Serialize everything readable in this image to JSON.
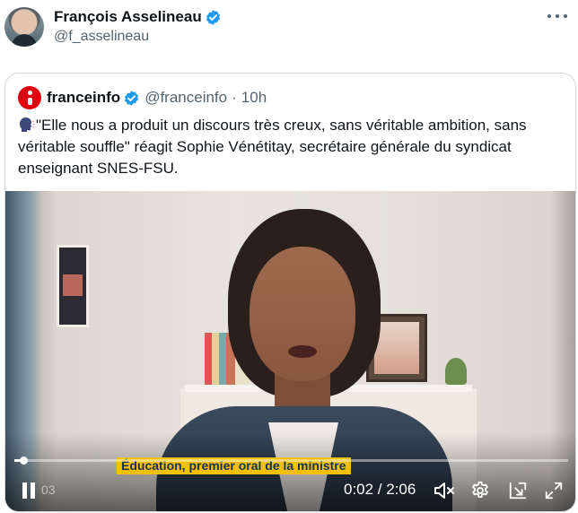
{
  "post": {
    "author_name": "François Asselineau",
    "author_handle": "@f_asselineau",
    "more_icon": "more-horizontal-icon"
  },
  "quoted": {
    "name": "franceinfo",
    "handle": "@franceinfo",
    "separator": "·",
    "time": "10h",
    "text": "\"Elle nous a produit un discours très creux, sans véritable ambition, sans véritable souffle\" réagit Sophie Vénétitay, secrétaire générale du syndicat enseignant SNES-FSU.",
    "leading_icon": "speaking-head-icon"
  },
  "video": {
    "caption": "Éducation, premier oral de la ministre",
    "time_display": "0:02 / 2:06",
    "faded_time": "03",
    "progress": 0.016
  },
  "colors": {
    "verified": "#1d9bf0",
    "franceinfo_red": "#e1000f",
    "caption_bg": "#f2c000",
    "caption_text": "#153259"
  }
}
